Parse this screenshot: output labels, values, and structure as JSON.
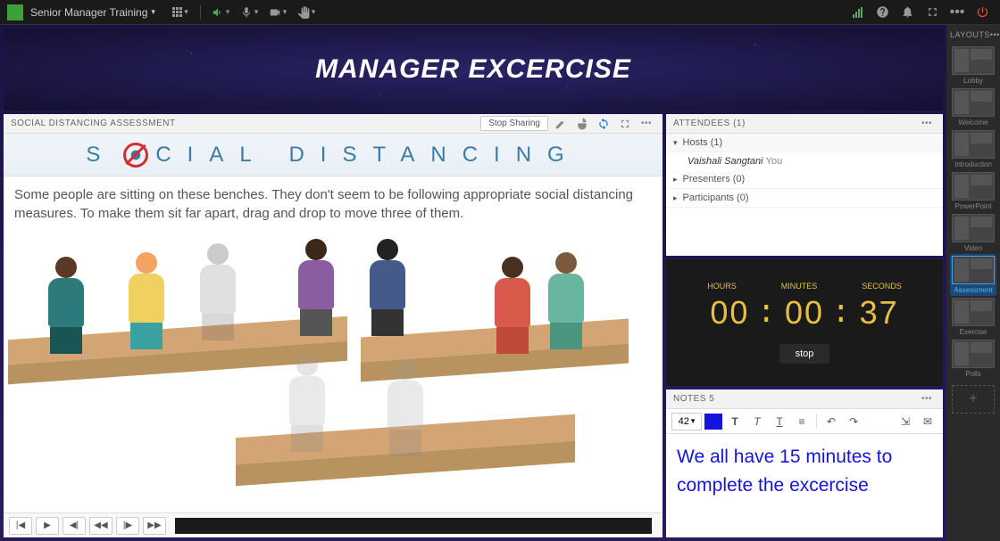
{
  "session_title": "Senior Manager Training",
  "banner_title": "MANAGER EXCERCISE",
  "share_pod": {
    "title": "SOCIAL DISTANCING ASSESSMENT",
    "stop_share": "Stop Sharing",
    "heading_pre": "S",
    "heading_post": "CIAL   DISTANCING",
    "body_text": "Some people are sitting on these benches. They don't seem to be following appropriate social distancing measures. To make them sit far apart, drag and drop to move three of them."
  },
  "attendees": {
    "title": "ATTENDEES",
    "count": "(1)",
    "hosts_label": "Hosts (1)",
    "presenters_label": "Presenters (0)",
    "participants_label": "Participants (0)",
    "host_name": "Vaishali Sangtani",
    "you_label": "You"
  },
  "timer": {
    "labels": {
      "h": "HOURS",
      "m": "MINUTES",
      "s": "SECONDS"
    },
    "hours": "00",
    "minutes": "00",
    "seconds": "37",
    "button": "stop"
  },
  "notes": {
    "title": "NOTES 5",
    "font_size": "42",
    "content": "We all have 15 minutes to complete the excercise"
  },
  "layouts": {
    "title": "LAYOUTS",
    "items": [
      "Lobby",
      "Welcome",
      "Introduction",
      "PowerPoint",
      "Video",
      "Assessment",
      "Exercise",
      "Polls"
    ],
    "active": "Assessment"
  }
}
